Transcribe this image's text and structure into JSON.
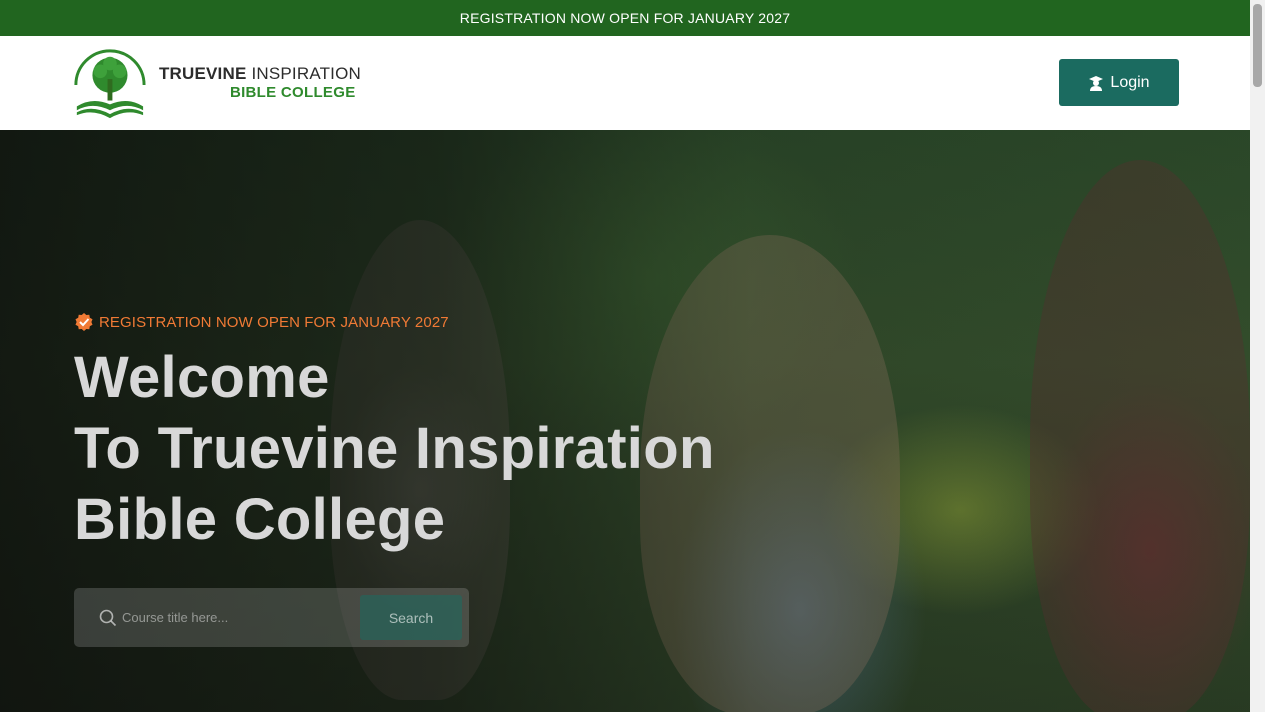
{
  "topbar": {
    "text": "REGISTRATION NOW OPEN FOR JANUARY 2027"
  },
  "header": {
    "logo": {
      "line1_bold": "TRUEVINE",
      "line1_light": "INSPIRATION",
      "line2": "BIBLE COLLEGE",
      "icon": "tree-book-logo"
    },
    "login": {
      "label": "Login",
      "icon": "user-graduate-icon"
    }
  },
  "hero": {
    "badge": {
      "text": "REGISTRATION NOW OPEN FOR JANUARY 2027",
      "icon": "check-badge-icon"
    },
    "headline": {
      "line1": "Welcome",
      "line2": "To Truevine Inspiration",
      "line3": "Bible College"
    },
    "search": {
      "placeholder": "Course title here...",
      "value": "",
      "button_label": "Search",
      "icon": "search-icon"
    }
  },
  "colors": {
    "brand_green": "#21651f",
    "teal": "#1b6b60",
    "accent_orange": "#f07a35"
  }
}
